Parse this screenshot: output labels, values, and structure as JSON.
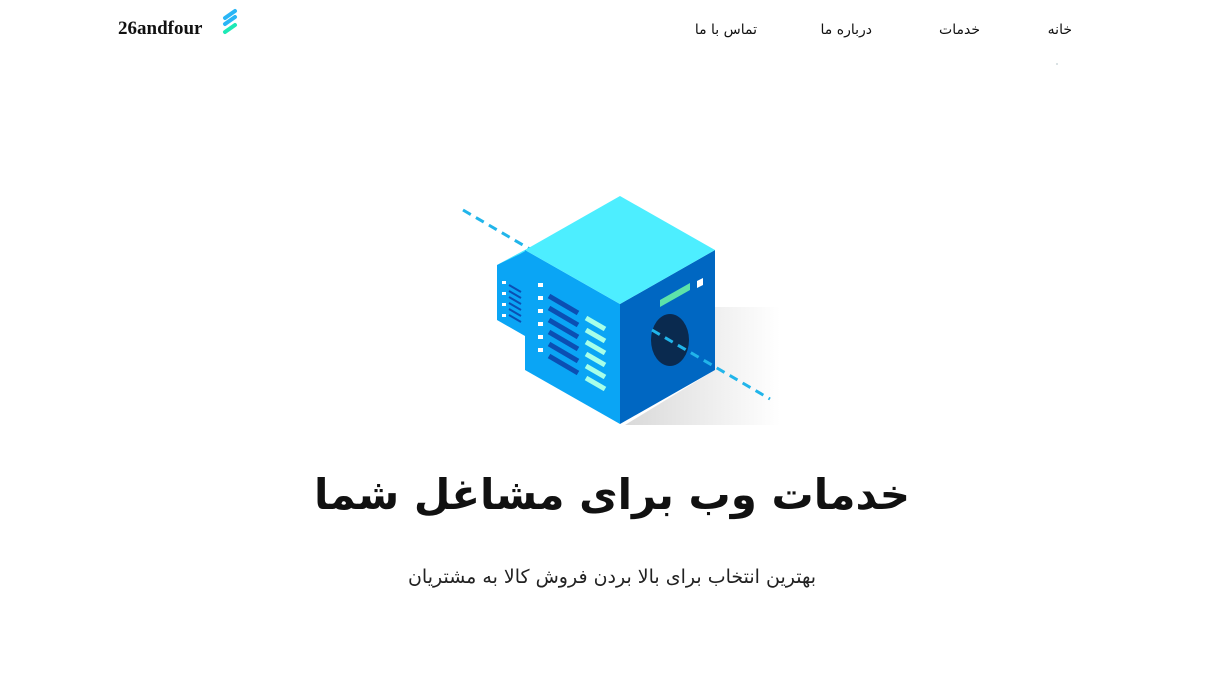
{
  "header": {
    "logo_text": "26andfour",
    "nav": {
      "home": "خانه",
      "services": "خدمات",
      "about": "درباره ما",
      "contact": "تماس با ما"
    }
  },
  "hero": {
    "headline": "خدمات وب برای مشاغل شما",
    "subline": "بهترین انتخاب برای بالا بردن فروش کالا به مشتریان",
    "illustration": "isometric-server-building-icon"
  },
  "colors": {
    "logo_mark_blue": "#29b6f6",
    "logo_mark_green": "#1de9b6",
    "cube_top": "#4deeff",
    "cube_left": "#0aa5f5",
    "cube_right": "#0067c2",
    "dashed_line": "#21b5ea"
  }
}
